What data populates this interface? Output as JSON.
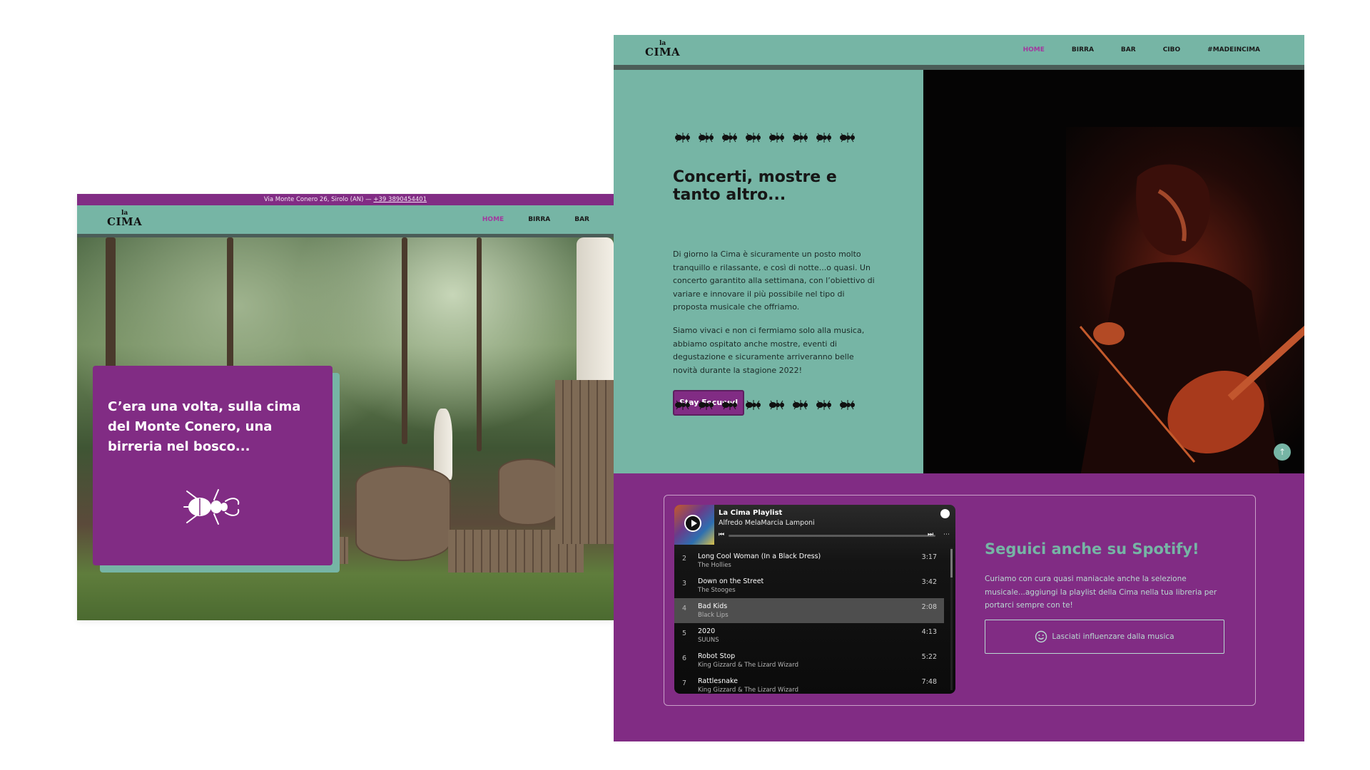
{
  "left_page": {
    "topbar": {
      "address": "Via Monte Conero 26, Sirolo (AN) —",
      "phone": "+39 3890454401"
    },
    "logo": {
      "top": "la",
      "main": "CIMA"
    },
    "nav": {
      "home": "HOME",
      "birra": "BIRRA",
      "bar": "BAR"
    },
    "intro": {
      "text": "C’era una volta, sulla cima del Monte Conero, una birreria nel bosco..."
    },
    "icons": {
      "beetle": "beetle-icon",
      "forest_photo": "forest-photo"
    }
  },
  "right_page": {
    "logo": {
      "top": "la",
      "main": "CIMA"
    },
    "nav": {
      "home": "HOME",
      "birra": "BIRRA",
      "bar": "BAR",
      "cibo": "CIBO",
      "madeincima": "#MADEINCIMA"
    },
    "events": {
      "title": "Concerti, mostre e tanto altro...",
      "p1": "Di giorno la Cima è sicuramente un posto molto tranquillo e rilassante, e così di notte...o quasi. Un concerto garantito alla settimana, con l’obiettivo di variare e innovare il più possibile nel tipo di proposta musicale che offriamo.",
      "p2": "Siamo vivaci e non ci fermiamo solo alla musica, abbiamo ospitato anche mostre, eventi di degustazione e sicuramente arriveranno belle novità durante la stagione 2022!",
      "button": "Stay Focused"
    },
    "scroll_top": "↑",
    "player": {
      "playlist_title": "La Cima Playlist",
      "owner": "Alfredo MelaMarcia Lamponi",
      "tracks": [
        {
          "num": "2",
          "name": "Long Cool Woman (In a Black Dress)",
          "artist": "The Hollies",
          "duration": "3:17"
        },
        {
          "num": "3",
          "name": "Down on the Street",
          "artist": "The Stooges",
          "duration": "3:42"
        },
        {
          "num": "4",
          "name": "Bad Kids",
          "artist": "Black Lips",
          "duration": "2:08"
        },
        {
          "num": "5",
          "name": "2020",
          "artist": "SUUNS",
          "duration": "4:13"
        },
        {
          "num": "6",
          "name": "Robot Stop",
          "artist": "King Gizzard & The Lizard Wizard",
          "duration": "5:22"
        },
        {
          "num": "7",
          "name": "Rattlesnake",
          "artist": "King Gizzard & The Lizard Wizard",
          "duration": "7:48"
        }
      ]
    },
    "spotify": {
      "heading": "Seguici anche su Spotify!",
      "description": "Curiamo con cura quasi maniacale anche la selezione musicale...aggiungi la playlist della Cima nella tua libreria per portarci sempre con te!",
      "button": "Lasciati influenzare dalla musica"
    }
  },
  "colors": {
    "teal": "#76b5a5",
    "purple": "#812c84",
    "nav_active": "#a3379f",
    "dark_bar": "#4b5d58"
  }
}
